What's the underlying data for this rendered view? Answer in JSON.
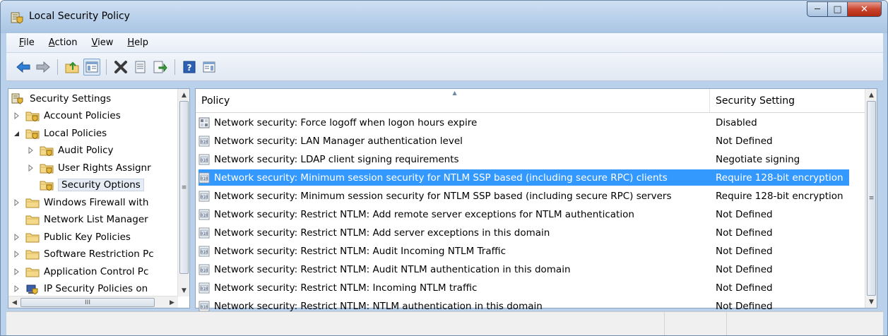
{
  "window": {
    "title": "Local Security Policy"
  },
  "menu": [
    {
      "label": "File",
      "key": "F",
      "rest": "ile"
    },
    {
      "label": "Action",
      "key": "A",
      "rest": "ction"
    },
    {
      "label": "View",
      "key": "V",
      "rest": "iew"
    },
    {
      "label": "Help",
      "key": "H",
      "rest": "elp"
    }
  ],
  "tree": {
    "root": "Security Settings",
    "items": [
      {
        "label": "Account Policies",
        "level": 1,
        "expander": "collapsed"
      },
      {
        "label": "Local Policies",
        "level": 1,
        "expander": "expanded"
      },
      {
        "label": "Audit Policy",
        "level": 2,
        "expander": "collapsed"
      },
      {
        "label": "User Rights Assignr",
        "level": 2,
        "expander": "collapsed"
      },
      {
        "label": "Security Options",
        "level": 2,
        "expander": "none",
        "selected": true
      },
      {
        "label": "Windows Firewall with",
        "level": 1,
        "expander": "collapsed"
      },
      {
        "label": "Network List Manager",
        "level": 1,
        "expander": "none"
      },
      {
        "label": "Public Key Policies",
        "level": 1,
        "expander": "collapsed"
      },
      {
        "label": "Software Restriction Pc",
        "level": 1,
        "expander": "collapsed"
      },
      {
        "label": "Application Control Pc",
        "level": 1,
        "expander": "collapsed"
      },
      {
        "label": "IP Security Policies on",
        "level": 1,
        "expander": "collapsed"
      }
    ],
    "hscroll_grip": "III"
  },
  "list": {
    "columns": {
      "policy": "Policy",
      "setting": "Security Setting"
    },
    "rows": [
      {
        "policy": "Network security: Force logoff when logon hours expire",
        "setting": "Disabled",
        "icon": "boolean-policy-icon"
      },
      {
        "policy": "Network security: LAN Manager authentication level",
        "setting": "Not Defined",
        "icon": "policy-icon"
      },
      {
        "policy": "Network security: LDAP client signing requirements",
        "setting": "Negotiate signing",
        "icon": "policy-icon"
      },
      {
        "policy": "Network security: Minimum session security for NTLM SSP based (including secure RPC) clients",
        "setting": "Require 128-bit encryption",
        "icon": "policy-icon",
        "selected": true
      },
      {
        "policy": "Network security: Minimum session security for NTLM SSP based (including secure RPC) servers",
        "setting": "Require 128-bit encryption",
        "icon": "policy-icon"
      },
      {
        "policy": "Network security: Restrict NTLM: Add remote server exceptions for NTLM authentication",
        "setting": "Not Defined",
        "icon": "policy-icon"
      },
      {
        "policy": "Network security: Restrict NTLM: Add server exceptions in this domain",
        "setting": "Not Defined",
        "icon": "policy-icon"
      },
      {
        "policy": "Network security: Restrict NTLM: Audit Incoming NTLM Traffic",
        "setting": "Not Defined",
        "icon": "policy-icon"
      },
      {
        "policy": "Network security: Restrict NTLM: Audit NTLM authentication in this domain",
        "setting": "Not Defined",
        "icon": "policy-icon"
      },
      {
        "policy": "Network security: Restrict NTLM: Incoming NTLM traffic",
        "setting": "Not Defined",
        "icon": "policy-icon"
      },
      {
        "policy": "Network security: Restrict NTLM: NTLM authentication in this domain",
        "setting": "Not Defined",
        "icon": "policy-icon"
      }
    ]
  },
  "colors": {
    "selection": "#3399ff",
    "frame": "#b9d1ea",
    "close_button": "#c9442e"
  }
}
